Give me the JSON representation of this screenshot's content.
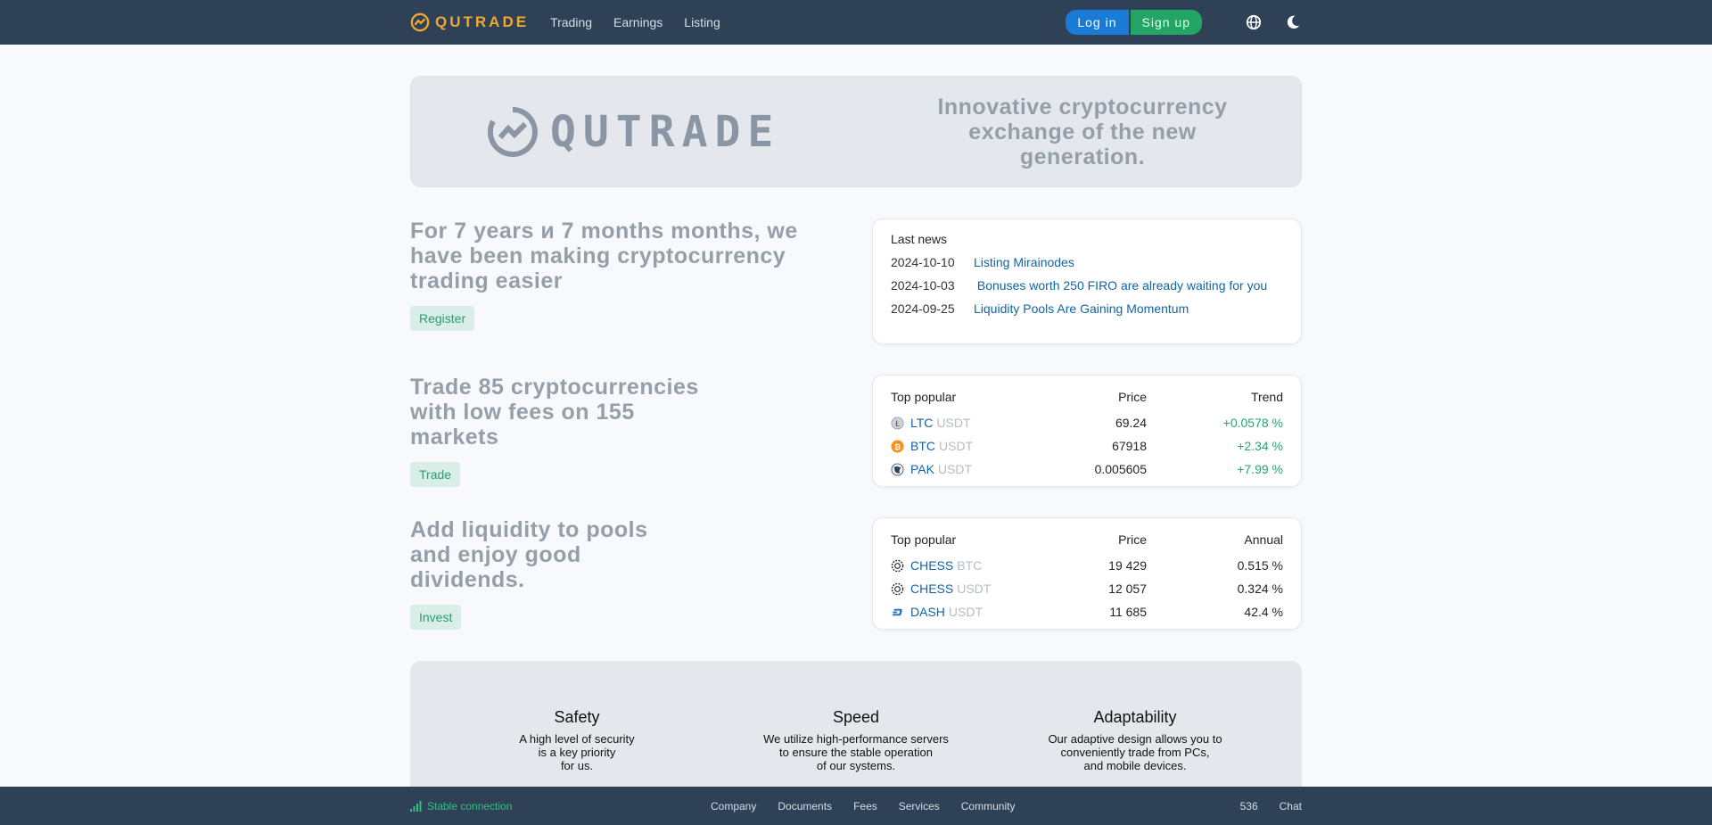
{
  "header": {
    "brand": "QUTRADE",
    "nav": [
      "Trading",
      "Earnings",
      "Listing"
    ],
    "login_label": "Log in",
    "signup_label": "Sign up"
  },
  "banner": {
    "wordmark": "QUTRADE",
    "tagline": "Innovative cryptocurrency exchange of the new generation."
  },
  "promos": [
    {
      "title": "For 7 years и 7 months months, we have been making cryptocurrency trading easier",
      "button": "Register"
    },
    {
      "title": "Trade 85 cryptocurrencies with low fees on 155 markets",
      "button": "Trade"
    },
    {
      "title": "Add liquidity to pools and enjoy good dividends.",
      "button": "Invest"
    }
  ],
  "news": {
    "heading": "Last news",
    "items": [
      {
        "date": "2024-10-10",
        "title": "Listing Mirainodes"
      },
      {
        "date": "2024-10-03",
        "title": "Bonuses worth 250 FIRO are already waiting for you"
      },
      {
        "date": "2024-09-25",
        "title": "Liquidity Pools Are Gaining Momentum"
      }
    ]
  },
  "popular": {
    "col_name": "Top popular",
    "col_price": "Price",
    "col_trend": "Trend",
    "rows": [
      {
        "symbol": "LTC",
        "quote": "USDT",
        "price": "69.24",
        "trend": "+0.0578 %",
        "icon": "ltc-icon"
      },
      {
        "symbol": "BTC",
        "quote": "USDT",
        "price": "67918",
        "trend": "+2.34 %",
        "icon": "btc-icon"
      },
      {
        "symbol": "PAK",
        "quote": "USDT",
        "price": "0.005605",
        "trend": "+7.99 %",
        "icon": "pak-icon"
      }
    ]
  },
  "pools": {
    "col_name": "Top popular",
    "col_price": "Price",
    "col_annual": "Annual",
    "rows": [
      {
        "symbol": "CHESS",
        "quote": "BTC",
        "price": "19 429",
        "annual": "0.515 %",
        "icon": "chess-icon"
      },
      {
        "symbol": "CHESS",
        "quote": "USDT",
        "price": "12 057",
        "annual": "0.324 %",
        "icon": "chess-icon"
      },
      {
        "symbol": "DASH",
        "quote": "USDT",
        "price": "11 685",
        "annual": "42.4 %",
        "icon": "dash-icon"
      }
    ]
  },
  "features": [
    {
      "title": "Safety",
      "text": "A high level of security\nis a key priority\nfor us."
    },
    {
      "title": "Speed",
      "text": "We utilize high-performance servers\nto ensure the stable operation\nof our systems."
    },
    {
      "title": "Adaptability",
      "text": "Our adaptive design allows you to\nconveniently trade from PCs,\nand mobile devices."
    }
  ],
  "footer": {
    "status": "Stable connection",
    "links": [
      "Company",
      "Documents",
      "Fees",
      "Services",
      "Community"
    ],
    "online_count": "536",
    "chat_label": "Chat"
  },
  "colors": {
    "header_bg": "#2e4157",
    "brand": "#f0a830",
    "login": "#1a7bd6",
    "signup": "#22a565",
    "link": "#1264a3",
    "positive": "#25a572"
  }
}
